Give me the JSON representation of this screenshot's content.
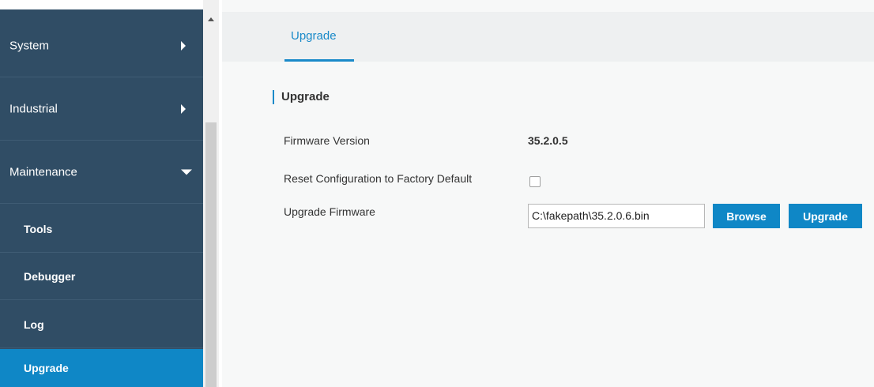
{
  "sidebar": {
    "menu": [
      {
        "label": "System",
        "expanded": false
      },
      {
        "label": "Industrial",
        "expanded": false
      },
      {
        "label": "Maintenance",
        "expanded": true
      }
    ],
    "submenu": [
      {
        "label": "Tools",
        "active": false
      },
      {
        "label": "Debugger",
        "active": false
      },
      {
        "label": "Log",
        "active": false
      },
      {
        "label": "Upgrade",
        "active": true
      }
    ]
  },
  "tabs": [
    {
      "label": "Upgrade",
      "active": true
    }
  ],
  "section": {
    "title": "Upgrade"
  },
  "fields": {
    "firmware_version": {
      "label": "Firmware Version",
      "value": "35.2.0.5"
    },
    "reset_config": {
      "label": "Reset Configuration to Factory Default",
      "checked": false
    },
    "upgrade_firmware": {
      "label": "Upgrade Firmware",
      "file_value": "C:\\fakepath\\35.2.0.6.bin",
      "browse_label": "Browse",
      "upgrade_label": "Upgrade"
    }
  },
  "colors": {
    "sidebar_bg": "#304d65",
    "active_bg": "#0f87c6",
    "accent": "#1a8ac9"
  },
  "icons": {
    "collapsed": "arrow-right-icon",
    "expanded": "arrow-down-icon",
    "scroll_up": "scroll-up-icon"
  }
}
